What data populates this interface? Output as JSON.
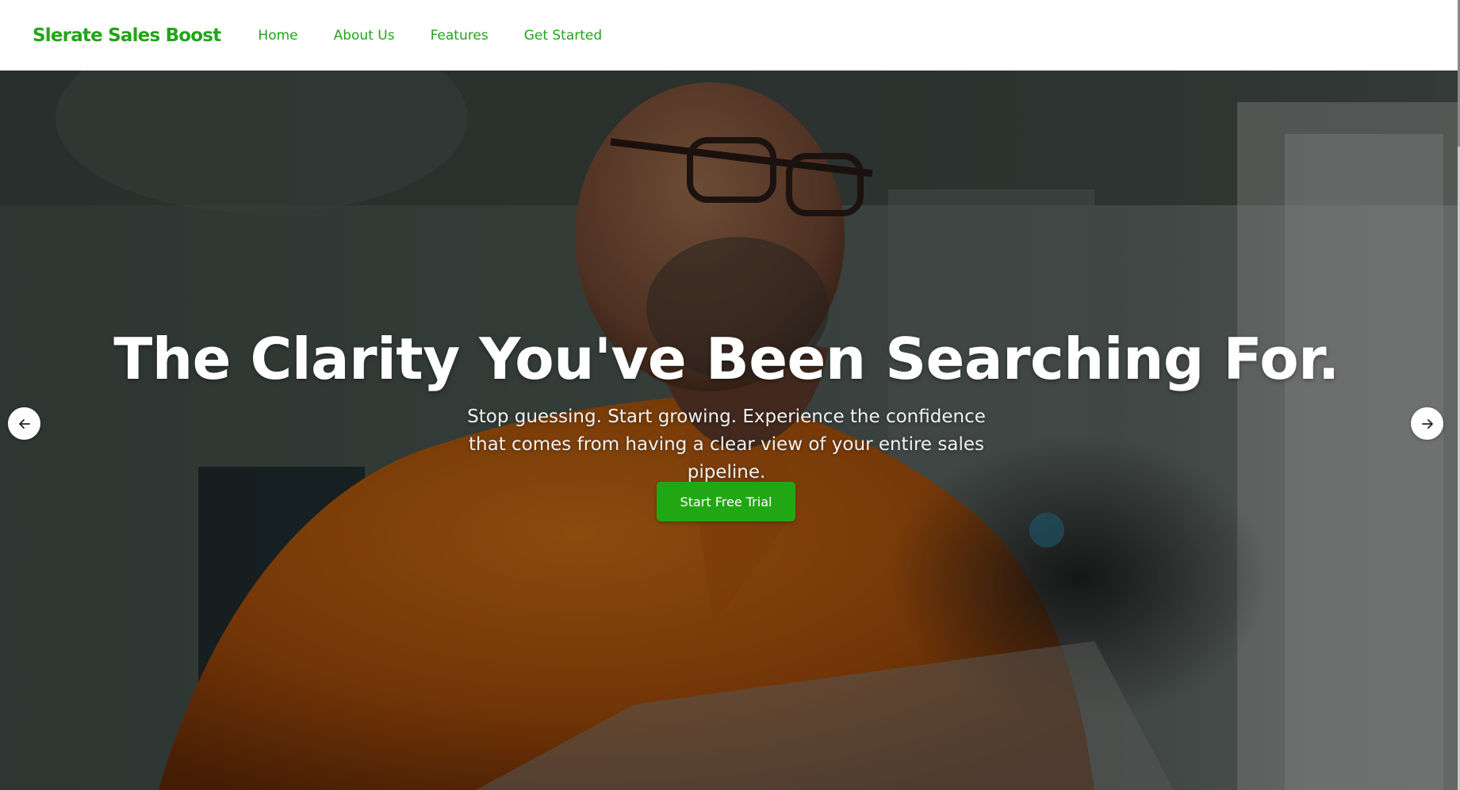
{
  "navbar": {
    "brand": "Slerate Sales Boost",
    "links": [
      "Home",
      "About Us",
      "Features",
      "Get Started"
    ]
  },
  "hero": {
    "title": "The Clarity You've Been Searching For.",
    "subtitle": "Stop guessing. Start growing. Experience the confidence that comes from having a clear view of your entire sales pipeline.",
    "cta_label": "Start Free Trial",
    "prev_icon": "arrow-left-icon",
    "next_icon": "arrow-right-icon"
  },
  "colors": {
    "brand_green": "#23a41a",
    "cta_green": "#22a714",
    "overlay": "rgba(0,0,0,0.38)"
  }
}
